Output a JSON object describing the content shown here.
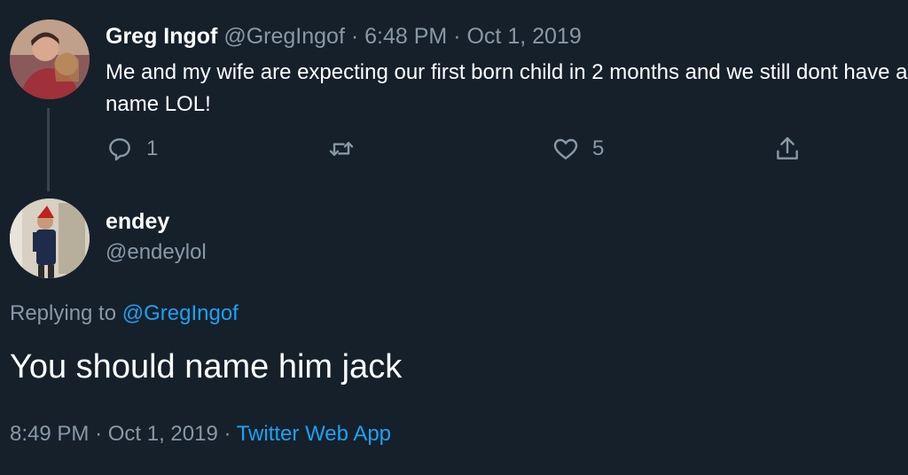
{
  "tweet": {
    "author_name": "Greg Ingof",
    "author_handle": "@GregIngof",
    "sep1": "·",
    "time": "6:48 PM",
    "sep2": "·",
    "date": "Oct 1, 2019",
    "text": "Me and my wife are expecting our first born child in 2 months and we still dont have a name LOL!",
    "reply_count": "1",
    "like_count": "5"
  },
  "reply": {
    "author_name": "endey",
    "author_handle": "@endeylol",
    "replying_prefix": "Replying to",
    "replying_to": "@GregIngof",
    "text": "You should name him jack",
    "time": "8:49 PM",
    "sep1": "·",
    "date": "Oct 1, 2019",
    "sep2": "·",
    "source": "Twitter Web App"
  },
  "icons": {
    "reply": "comment-icon",
    "retweet": "retweet-icon",
    "like": "heart-icon",
    "share": "share-icon"
  },
  "colors": {
    "background": "#15202b",
    "muted": "#8899a6",
    "link": "#1da1f2",
    "thread_line": "#38444d"
  }
}
